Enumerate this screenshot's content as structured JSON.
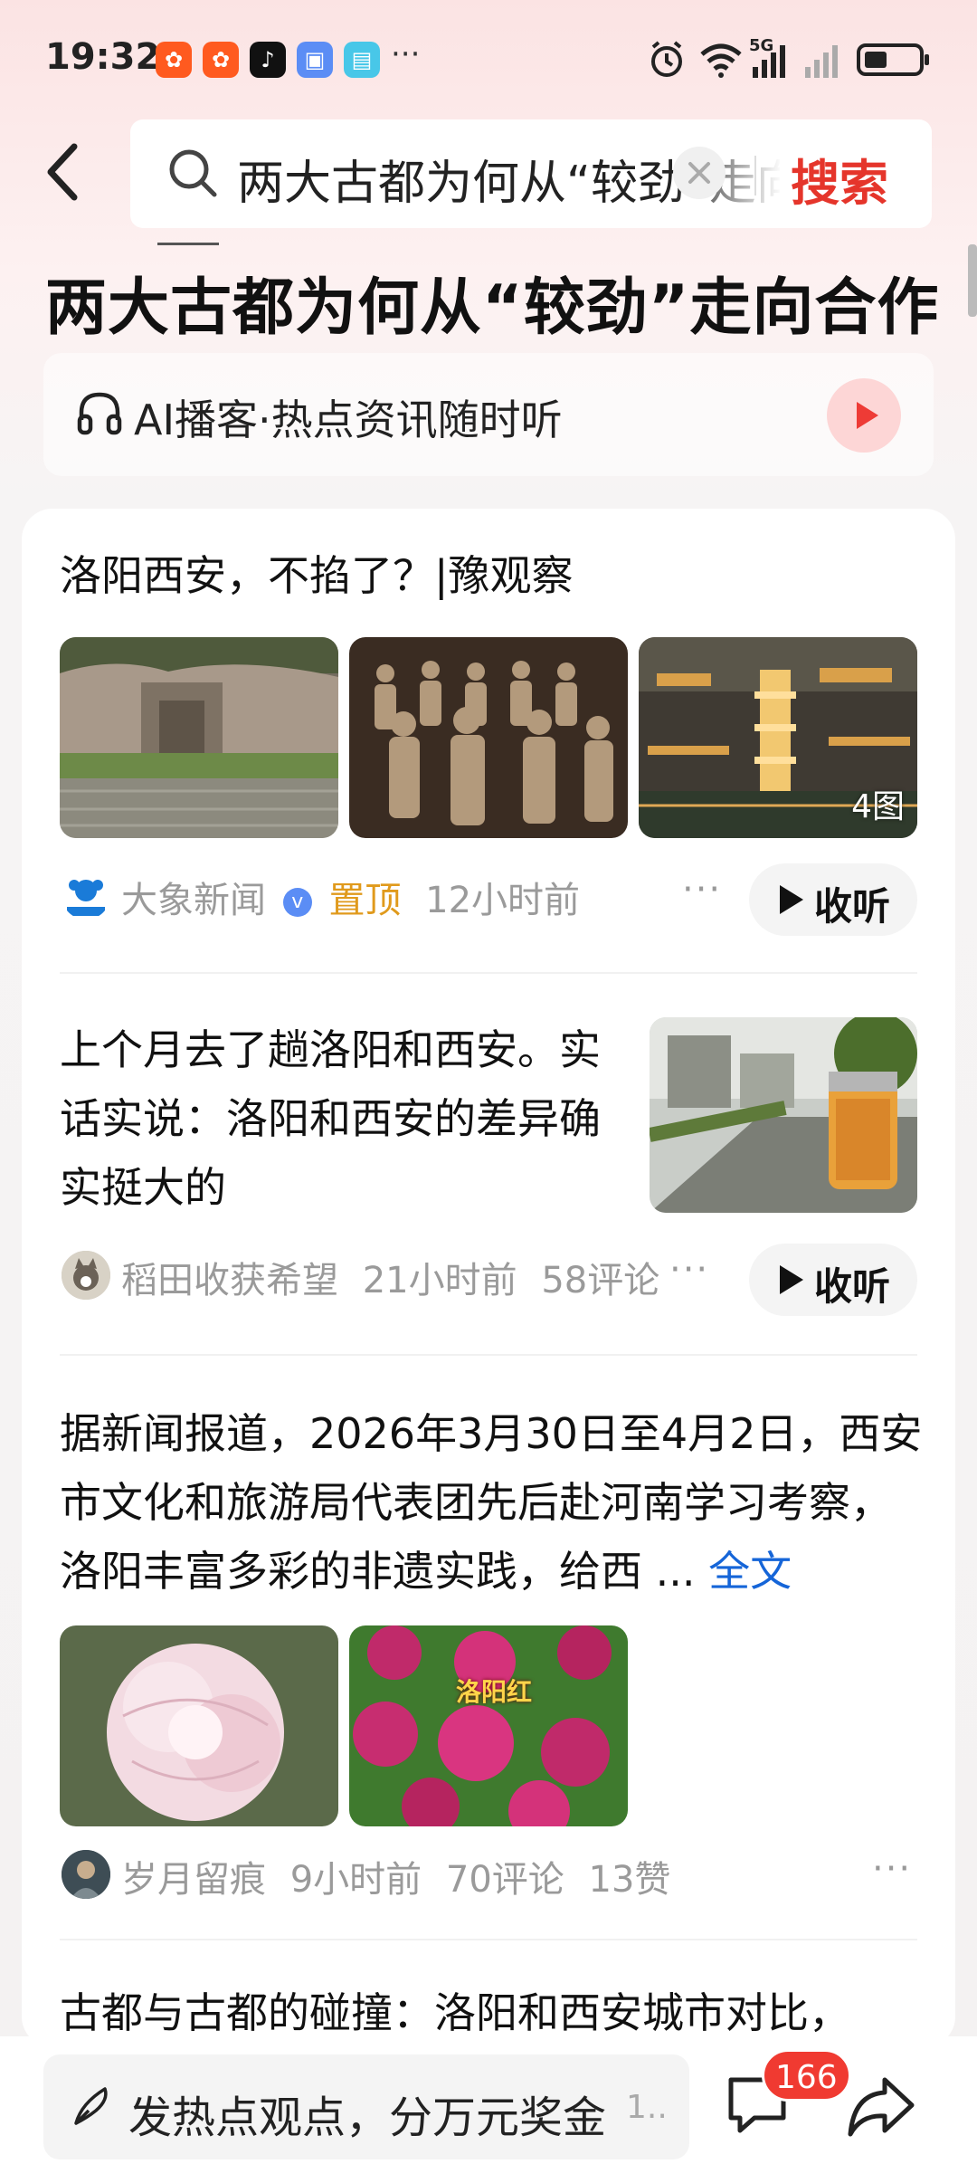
{
  "status_bar": {
    "time": "19:32",
    "app_icons": [
      "kuaishou-icon",
      "kuaishou-icon",
      "tiktok-icon",
      "wallet-icon",
      "reader-icon"
    ],
    "more": "···",
    "network": "5G"
  },
  "search": {
    "query": "两大古都为何从“较劲”走向合作",
    "button": "搜索"
  },
  "topic": {
    "title": "两大古都为何从“较劲”走向合作"
  },
  "ai_bar": {
    "label": "AI播客·热点资讯随时听"
  },
  "articles": [
    {
      "title": "洛阳西安，不掐了？|豫观察",
      "image_count": "4图",
      "source": "大象新闻",
      "pinned": "置顶",
      "time": "12小时前",
      "listen": "收听"
    },
    {
      "title": "上个月去了趟洛阳和西安。实话实说：洛阳和西安的差异确实挺大的",
      "source": "稻田收获希望",
      "time": "21小时前",
      "comments": "58评论",
      "listen": "收听"
    },
    {
      "text": "据新闻报道，2026年3月30日至4月2日，西安市文化和旅游局代表团先后赴河南学习考察，洛阳丰富多彩的非遗实践，给西",
      "ellipsis": "...",
      "full_text": "全文",
      "image_caption": "洛阳红",
      "source": "岁月留痕",
      "time": "9小时前",
      "comments": "70评论",
      "likes": "13赞"
    },
    {
      "title": "古都与古都的碰撞：洛阳和西安城市对比，"
    }
  ],
  "bottom": {
    "comment_prompt": "发热点观点，分万元奖金",
    "comment_more": "1..",
    "comment_count": "166"
  },
  "colors": {
    "accent": "#e5352b",
    "link": "#1565d8",
    "pinned": "#e09a1c"
  }
}
